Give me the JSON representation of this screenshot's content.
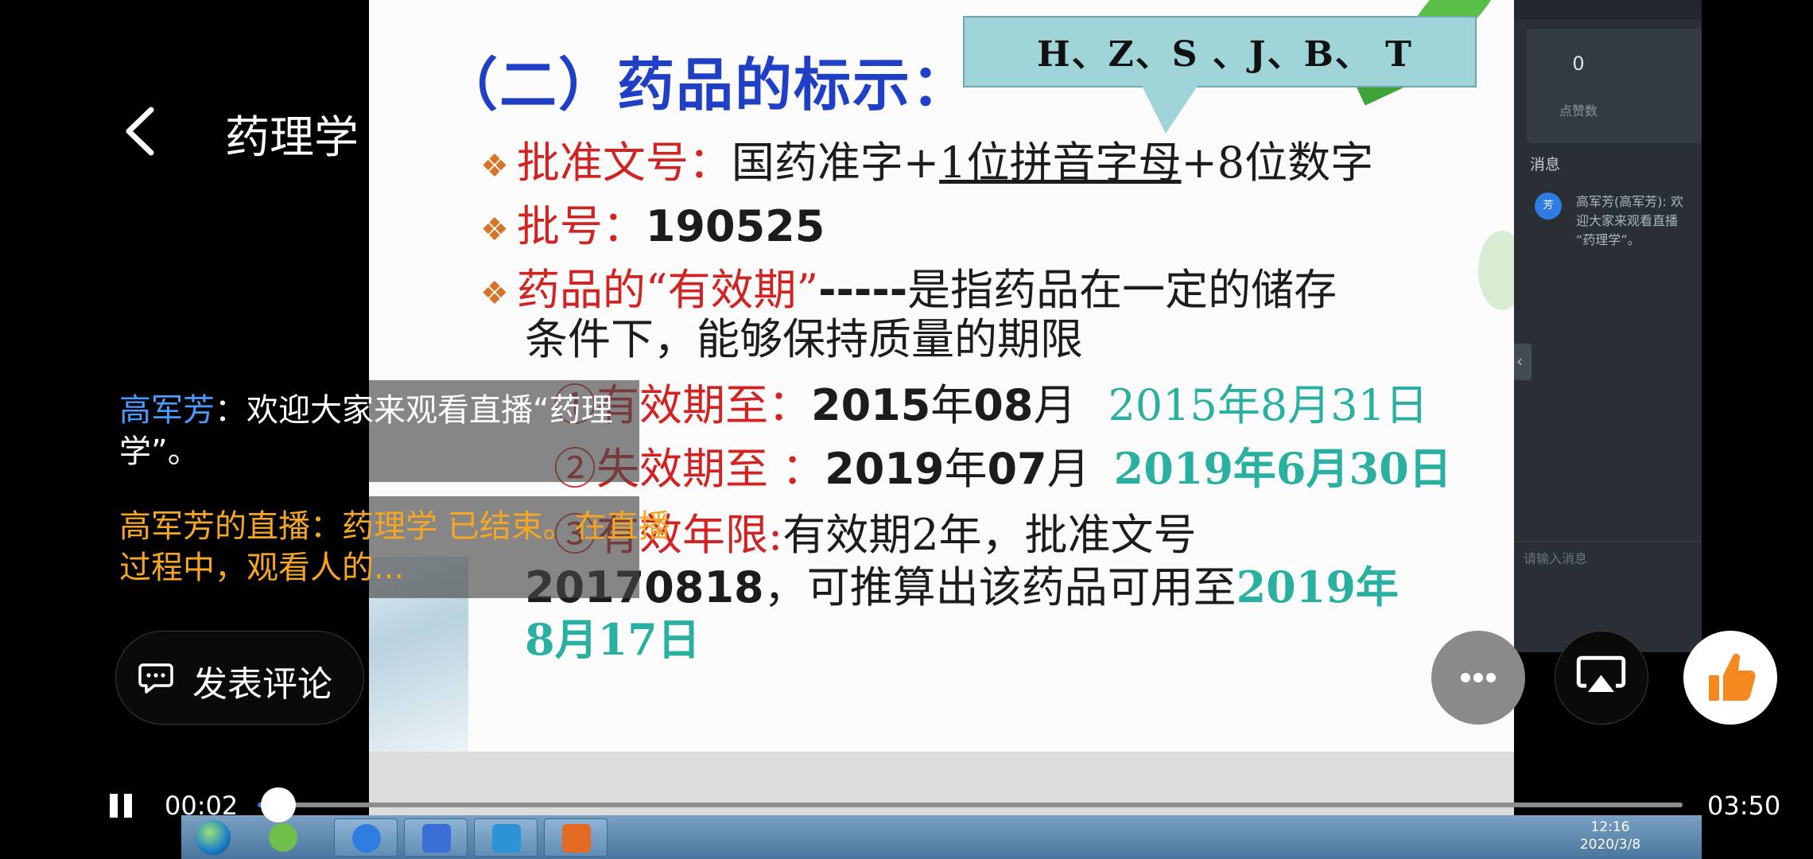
{
  "header": {
    "title": "药理学"
  },
  "slide": {
    "title": "（二）药品的标示：",
    "callout": "H、Z、S 、J、B、 T",
    "line1": {
      "label": "批准文号：",
      "pre": "国药准字+",
      "underlined": "1位拼音字母",
      "post": "+8位数字"
    },
    "line2": {
      "label": "批号：",
      "value": "190525"
    },
    "line3": {
      "label": "药品的“有效期”",
      "dashes": "-----",
      "text": "是指药品在一定的储存"
    },
    "line4": "条件下，能够保持质量的期限",
    "item1": {
      "marker": "①",
      "label": "有效期至：",
      "y": "2015",
      "ysuf": "年",
      "m": "08",
      "msuf": "月",
      "note": "2015年8月31日"
    },
    "item2": {
      "marker": "②",
      "label": "失效期至 ：",
      "y": "2019",
      "ysuf": "年",
      "m": "07",
      "msuf": "月",
      "note": "2019年6月30日"
    },
    "item3": {
      "marker": "③",
      "label": "有效年限:",
      "text": "有效期2年，批准文号"
    },
    "item3b": {
      "num": "20170818",
      "text": "，可推算出该药品可用至",
      "teal": "2019年"
    },
    "item3c": "8月17日"
  },
  "side_panel": {
    "like_count": "0",
    "like_count_label": "点赞数",
    "messages_title": "消息",
    "avatar_text": "芳",
    "message": "高军芳(高军芳): 欢迎大家来观看直播 “药理学”。",
    "input_placeholder": "请输入消息"
  },
  "taskbar": {
    "time": "12:16",
    "date": "2020/3/8"
  },
  "chat": [
    {
      "name": "高军芳",
      "sep": "：",
      "text": "欢迎大家来观看直播“药理学”。"
    },
    {
      "text": "高军芳的直播：药理学 已结束。在直播过程中，观看人的..."
    }
  ],
  "comment_button": {
    "label": "发表评论"
  },
  "player": {
    "current_time": "00:02",
    "total_time": "03:50",
    "progress": 0.0145
  },
  "colors": {
    "accent": "#2f7de0",
    "chat_name": "#4a9bff",
    "system_msg": "#f5a623",
    "like": "#f5891f"
  },
  "icons": [
    "back-arrow-icon",
    "comment-icon",
    "more-icon",
    "cast-icon",
    "thumbs-up-icon",
    "pause-icon"
  ]
}
